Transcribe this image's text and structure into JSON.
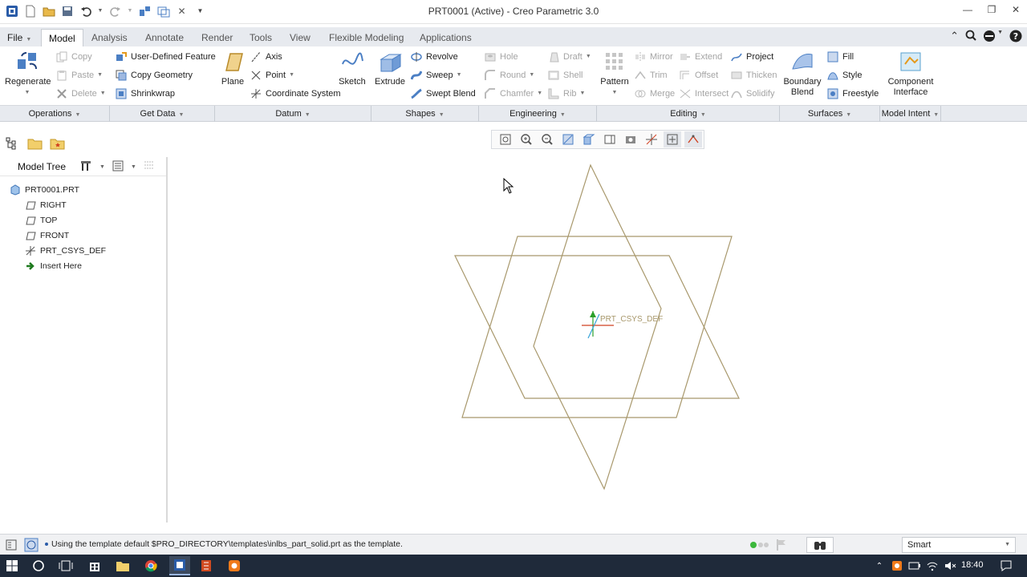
{
  "window": {
    "title": "PRT0001 (Active) - Creo Parametric 3.0"
  },
  "tabs": [
    {
      "label": "File",
      "name": "tab-file"
    },
    {
      "label": "Model",
      "name": "tab-model"
    },
    {
      "label": "Analysis",
      "name": "tab-analysis"
    },
    {
      "label": "Annotate",
      "name": "tab-annotate"
    },
    {
      "label": "Render",
      "name": "tab-render"
    },
    {
      "label": "Tools",
      "name": "tab-tools"
    },
    {
      "label": "View",
      "name": "tab-view"
    },
    {
      "label": "Flexible Modeling",
      "name": "tab-flexible-modeling"
    },
    {
      "label": "Applications",
      "name": "tab-applications"
    }
  ],
  "ribbon": {
    "regenerate": "Regenerate",
    "copy": "Copy",
    "paste": "Paste",
    "delete": "Delete",
    "user_defined_feature": "User-Defined Feature",
    "copy_geometry": "Copy Geometry",
    "shrinkwrap": "Shrinkwrap",
    "plane": "Plane",
    "axis": "Axis",
    "point": "Point",
    "coordinate_system": "Coordinate System",
    "sketch": "Sketch",
    "extrude": "Extrude",
    "revolve": "Revolve",
    "sweep": "Sweep",
    "swept_blend": "Swept Blend",
    "hole": "Hole",
    "round": "Round",
    "chamfer": "Chamfer",
    "draft": "Draft",
    "shell": "Shell",
    "rib": "Rib",
    "pattern": "Pattern",
    "mirror": "Mirror",
    "trim": "Trim",
    "merge": "Merge",
    "extend": "Extend",
    "offset": "Offset",
    "intersect": "Intersect",
    "project": "Project",
    "thicken": "Thicken",
    "solidify": "Solidify",
    "boundary_blend_1": "Boundary",
    "boundary_blend_2": "Blend",
    "fill": "Fill",
    "style": "Style",
    "freestyle": "Freestyle",
    "component_interface_1": "Component",
    "component_interface_2": "Interface"
  },
  "groups": {
    "operations": "Operations",
    "get_data": "Get Data",
    "datum": "Datum",
    "shapes": "Shapes",
    "engineering": "Engineering",
    "editing": "Editing",
    "surfaces": "Surfaces",
    "model_intent": "Model Intent"
  },
  "model_tree": {
    "header": "Model Tree",
    "items": [
      {
        "label": "PRT0001.PRT",
        "icon": "part-icon"
      },
      {
        "label": "RIGHT",
        "icon": "datum-plane-icon"
      },
      {
        "label": "TOP",
        "icon": "datum-plane-icon"
      },
      {
        "label": "FRONT",
        "icon": "datum-plane-icon"
      },
      {
        "label": "PRT_CSYS_DEF",
        "icon": "csys-icon"
      },
      {
        "label": "Insert Here",
        "icon": "insert-arrow-icon"
      }
    ]
  },
  "graphics": {
    "csys_label": "PRT_CSYS_DEF",
    "datum_color": "#a8986c"
  },
  "status": {
    "message": "Using the template default $PRO_DIRECTORY\\templates\\inlbs_part_solid.prt as the template.",
    "filter": "Smart"
  },
  "taskbar": {
    "clock": "18:40"
  },
  "colors": {
    "accent": "#2a5ca8",
    "tab_bg": "#e7eaef",
    "taskbar": "#1f2a3a"
  }
}
